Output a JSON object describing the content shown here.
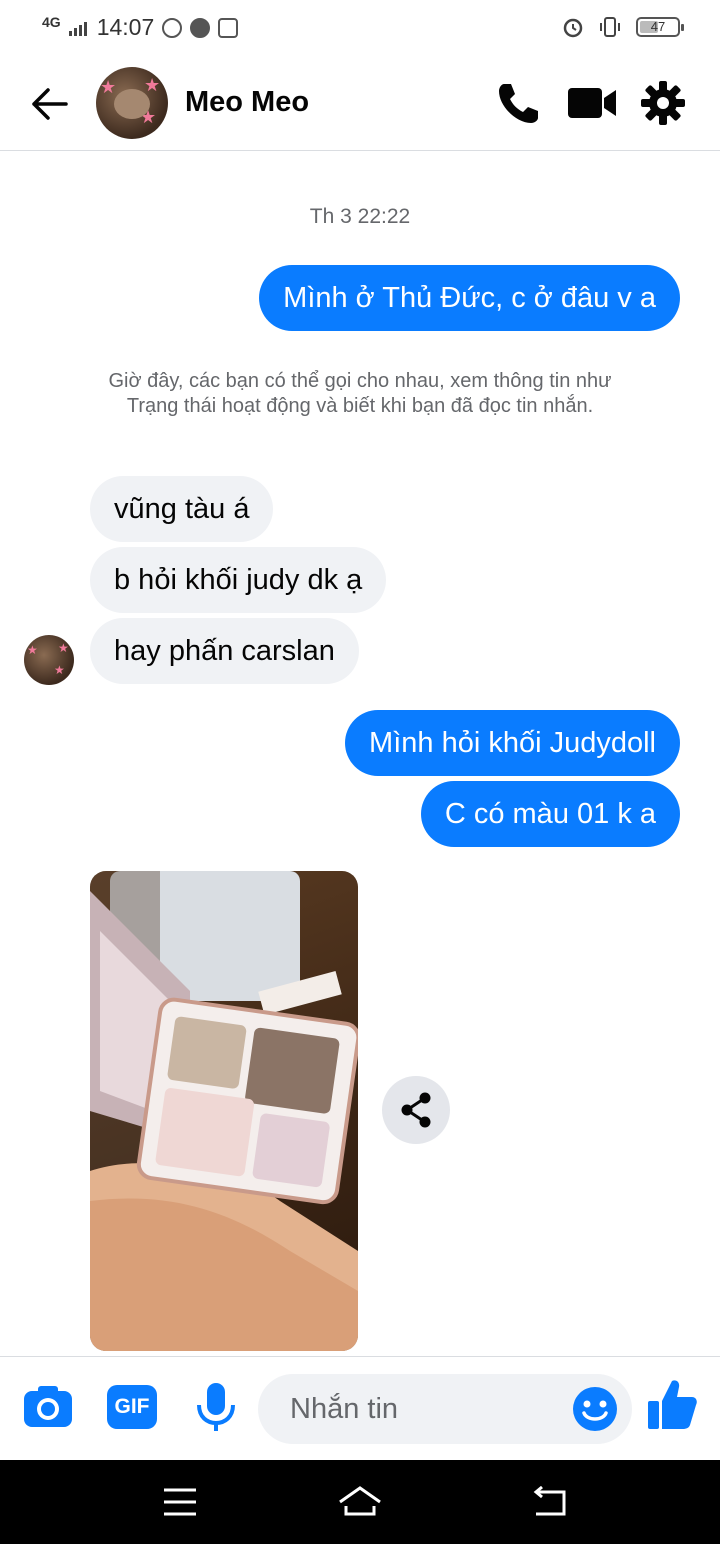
{
  "status_bar": {
    "network": "4G",
    "time": "14:07",
    "app_icons": [
      "zalo-icon",
      "globe-icon",
      "shopee-icon"
    ],
    "battery": "47"
  },
  "header": {
    "contact_name": "Meo Meo",
    "icons": [
      "back-arrow-icon",
      "phone-icon",
      "video-camera-icon",
      "gear-icon"
    ]
  },
  "conversation": {
    "timestamp": "Th 3 22:22",
    "notice": "Giờ đây, các bạn có thể gọi cho nhau, xem thông tin như Trạng thái hoạt động và biết khi bạn đã đọc tin nhắn.",
    "messages": [
      {
        "direction": "out",
        "text": "Mình ở Thủ Đức, c ở đâu v a"
      },
      {
        "direction": "in",
        "text": "vũng tàu á"
      },
      {
        "direction": "in",
        "text": "b hỏi khối judy dk ạ"
      },
      {
        "direction": "in",
        "text": "hay phấn carslan"
      },
      {
        "direction": "out",
        "text": "Mình hỏi khối Judydoll"
      },
      {
        "direction": "out",
        "text": "C có màu 01 k a"
      }
    ],
    "photo_message": {
      "direction": "in",
      "share_icon": "share-icon"
    }
  },
  "composer": {
    "placeholder": "Nhắn tin",
    "gif_label": "GIF",
    "icons": [
      "camera-icon",
      "gif-icon",
      "microphone-icon",
      "emoji-icon",
      "thumbs-up-icon"
    ]
  },
  "colors": {
    "accent": "#0a7cff",
    "incoming_bubble": "#f0f2f5",
    "muted_text": "#65676b"
  }
}
